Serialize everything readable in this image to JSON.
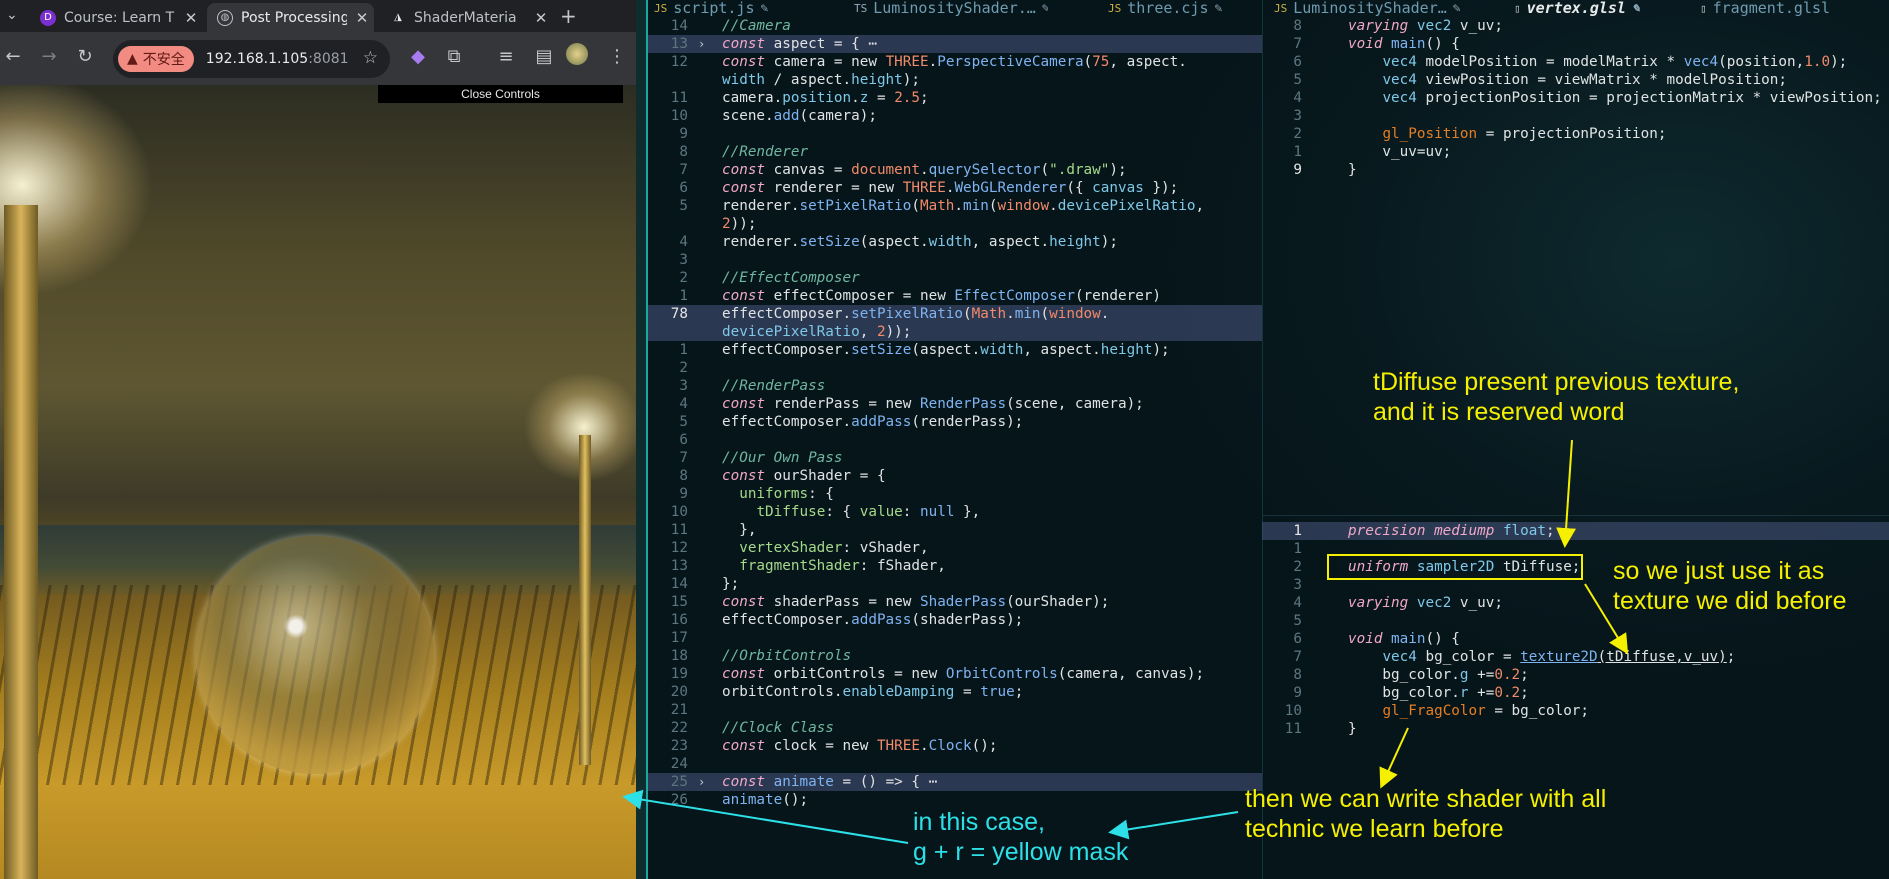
{
  "browser": {
    "tabs": [
      {
        "label": "Course: Learn T",
        "icon": "course-icon",
        "active": false
      },
      {
        "label": "Post Processing",
        "icon": "globe-icon",
        "active": true
      },
      {
        "label": "ShaderMateria",
        "icon": "threejs-icon",
        "active": false
      }
    ],
    "new_tab_label": "+",
    "omnibox": {
      "badge": "不安全",
      "host": "192.168.1.105",
      "port": ":8081"
    },
    "close_controls_label": "Close Controls"
  },
  "editor": {
    "tabs": [
      {
        "label": "script.js",
        "kind": "js",
        "active": false
      },
      {
        "label": "LuminosityShader.…",
        "kind": "ts",
        "active": false
      },
      {
        "label": "three.cjs",
        "kind": "js",
        "active": false
      },
      {
        "label": "LuminosityShader…",
        "kind": "js",
        "active": false
      },
      {
        "label": "vertex.glsl",
        "kind": "glsl",
        "active": true
      },
      {
        "label": "fragment.glsl",
        "kind": "glsl",
        "active": false
      }
    ],
    "left_lines": [
      {
        "ln": "14",
        "html": "<span class='c'>//Camera</span>"
      },
      {
        "ln": "13",
        "html": "<span class='k'>const</span> aspect = { ⋯",
        "hl": true,
        "fold": true
      },
      {
        "ln": "12",
        "html": "<span class='k'>const</span> camera = new <span class='n'>THREE</span>.<span class='cl'>PerspectiveCamera</span>(<span class='n'>75</span>, aspect."
      },
      {
        "ln": "",
        "html": "<span class='p'>width</span> / aspect.<span class='p'>height</span>);"
      },
      {
        "ln": "11",
        "html": "camera.<span class='p'>position</span>.<span class='p'>z</span> = <span class='n'>2.5</span>;"
      },
      {
        "ln": "10",
        "html": "scene.<span class='cl'>add</span>(camera);"
      },
      {
        "ln": "9",
        "html": ""
      },
      {
        "ln": "8",
        "html": "<span class='c'>//Renderer</span>"
      },
      {
        "ln": "7",
        "html": "<span class='k'>const</span> canvas = <span class='n'>document</span>.<span class='cl'>querySelector</span>(<span class='s'>\".draw\"</span>);"
      },
      {
        "ln": "6",
        "html": "<span class='k'>const</span> renderer = new <span class='n'>THREE</span>.<span class='cl'>WebGLRenderer</span>({ <span class='p'>canvas</span> });"
      },
      {
        "ln": "5",
        "html": "renderer.<span class='cl'>setPixelRatio</span>(<span class='n'>Math</span>.<span class='cl'>min</span>(<span class='n'>window</span>.<span class='p'>devicePixelRatio</span>,"
      },
      {
        "ln": "",
        "html": "<span class='n'>2</span>));"
      },
      {
        "ln": "4",
        "html": "renderer.<span class='cl'>setSize</span>(aspect.<span class='p'>width</span>, aspect.<span class='p'>height</span>);"
      },
      {
        "ln": "3",
        "html": ""
      },
      {
        "ln": "2",
        "html": "<span class='c'>//EffectComposer</span>"
      },
      {
        "ln": "1",
        "html": "<span class='k'>const</span> effectComposer = new <span class='cl'>EffectComposer</span>(renderer)"
      },
      {
        "ln": "78",
        "html": "effectComposer.<span class='cl'>setPixelRatio</span>(<span class='n'>Math</span>.<span class='cl'>min</span>(<span class='n'>window</span>.",
        "hl": true,
        "cur": true
      },
      {
        "ln": "",
        "html": "<span class='p'>devicePixelRatio</span>, <span class='n'>2</span>));",
        "hl": true
      },
      {
        "ln": "1",
        "html": "effectComposer.<span class='cl'>setSize</span>(aspect.<span class='p'>width</span>, aspect.<span class='p'>height</span>);"
      },
      {
        "ln": "2",
        "html": ""
      },
      {
        "ln": "3",
        "html": "<span class='c'>//RenderPass</span>"
      },
      {
        "ln": "4",
        "html": "<span class='k'>const</span> renderPass = new <span class='cl'>RenderPass</span>(scene, camera);"
      },
      {
        "ln": "5",
        "html": "effectComposer.<span class='cl'>addPass</span>(renderPass);"
      },
      {
        "ln": "6",
        "html": ""
      },
      {
        "ln": "7",
        "html": "<span class='c'>//Our Own Pass</span>"
      },
      {
        "ln": "8",
        "html": "<span class='k'>const</span> ourShader = {"
      },
      {
        "ln": "9",
        "html": "  <span class='s'>uniforms</span>: {"
      },
      {
        "ln": "10",
        "html": "    <span class='s'>tDiffuse</span>: { <span class='s'>value</span>: <span class='cl'>null</span> },"
      },
      {
        "ln": "11",
        "html": "  },"
      },
      {
        "ln": "12",
        "html": "  <span class='s'>vertexShader</span>: vShader,"
      },
      {
        "ln": "13",
        "html": "  <span class='s'>fragmentShader</span>: fShader,"
      },
      {
        "ln": "14",
        "html": "};"
      },
      {
        "ln": "15",
        "html": "<span class='k'>const</span> shaderPass = new <span class='cl'>ShaderPass</span>(ourShader);"
      },
      {
        "ln": "16",
        "html": "effectComposer.<span class='cl'>addPass</span>(shaderPass);"
      },
      {
        "ln": "17",
        "html": ""
      },
      {
        "ln": "18",
        "html": "<span class='c'>//OrbitControls</span>"
      },
      {
        "ln": "19",
        "html": "<span class='k'>const</span> orbitControls = new <span class='cl'>OrbitControls</span>(camera, canvas);"
      },
      {
        "ln": "20",
        "html": "orbitControls.<span class='p'>enableDamping</span> = <span class='cl'>true</span>;"
      },
      {
        "ln": "21",
        "html": ""
      },
      {
        "ln": "22",
        "html": "<span class='c'>//Clock Class</span>"
      },
      {
        "ln": "23",
        "html": "<span class='k'>const</span> clock = new <span class='n'>THREE</span>.<span class='cl'>Clock</span>();"
      },
      {
        "ln": "24",
        "html": ""
      },
      {
        "ln": "25",
        "html": "<span class='k'>const</span> <span class='cl'>animate</span> = () => { ⋯",
        "hl": true,
        "fold": true
      },
      {
        "ln": "26",
        "html": "<span class='cl'>animate</span>();"
      }
    ],
    "vertex_lines": [
      {
        "ln": "8",
        "html": "<span class='k'>varying</span> <span class='t'>vec2</span> v_uv;"
      },
      {
        "ln": "7",
        "html": "<span class='k'>void</span> <span class='cl'>main</span>() {"
      },
      {
        "ln": "6",
        "html": "    <span class='t'>vec4</span> modelPosition = modelMatrix * <span class='cl'>vec4</span>(position,<span class='n'>1.0</span>);"
      },
      {
        "ln": "5",
        "html": "    <span class='t'>vec4</span> viewPosition = viewMatrix * modelPosition;"
      },
      {
        "ln": "4",
        "html": "    <span class='t'>vec4</span> projectionPosition = projectionMatrix * viewPosition;"
      },
      {
        "ln": "3",
        "html": ""
      },
      {
        "ln": "2",
        "html": "    <span class='gr'>gl_Position</span> = projectionPosition;"
      },
      {
        "ln": "1",
        "html": "    v_uv=uv;"
      },
      {
        "ln": "9",
        "html": "}",
        "cur": true
      }
    ],
    "fragment_lines": [
      {
        "ln": "1",
        "html": "<span class='k'>precision</span> <span class='k'>mediump</span> <span class='t'>float</span>;",
        "hl": true,
        "cur": true
      },
      {
        "ln": "1",
        "html": ""
      },
      {
        "ln": "2",
        "html": "<span class='k'>uniform</span> <span class='t'>sampler2D</span> tDiffuse;"
      },
      {
        "ln": "3",
        "html": ""
      },
      {
        "ln": "4",
        "html": "<span class='k'>varying</span> <span class='t'>vec2</span> v_uv;"
      },
      {
        "ln": "5",
        "html": ""
      },
      {
        "ln": "6",
        "html": "<span class='k'>void</span> <span class='cl'>main</span>() {"
      },
      {
        "ln": "7",
        "html": "    <span class='t'>vec4</span> bg_color = <span class='cl u'>texture2D</span><span class='u'>(tDiffuse,v_uv)</span>;"
      },
      {
        "ln": "8",
        "html": "    bg_color.<span class='p'>g</span> +=<span class='n'>0.2</span>;"
      },
      {
        "ln": "9",
        "html": "    bg_color.<span class='p'>r</span> +=<span class='n'>0.2</span>;"
      },
      {
        "ln": "10",
        "html": "    <span class='gr'>gl_FragColor</span> = bg_color;"
      },
      {
        "ln": "11",
        "html": "}"
      }
    ]
  },
  "annotations": {
    "tdiffuse": "tDiffuse present previous texture,\nand it is reserved word",
    "use_it": "so we just use it as\ntexture we did before",
    "write_shader": "then we can write shader with all\ntechnic we learn before",
    "yellow_mask": "in this case,\ng + r = yellow mask"
  },
  "colors": {
    "annotation_yellow": "#f4f000",
    "annotation_cyan": "#2de0e8",
    "unsafe_badge": "#f28b82"
  }
}
